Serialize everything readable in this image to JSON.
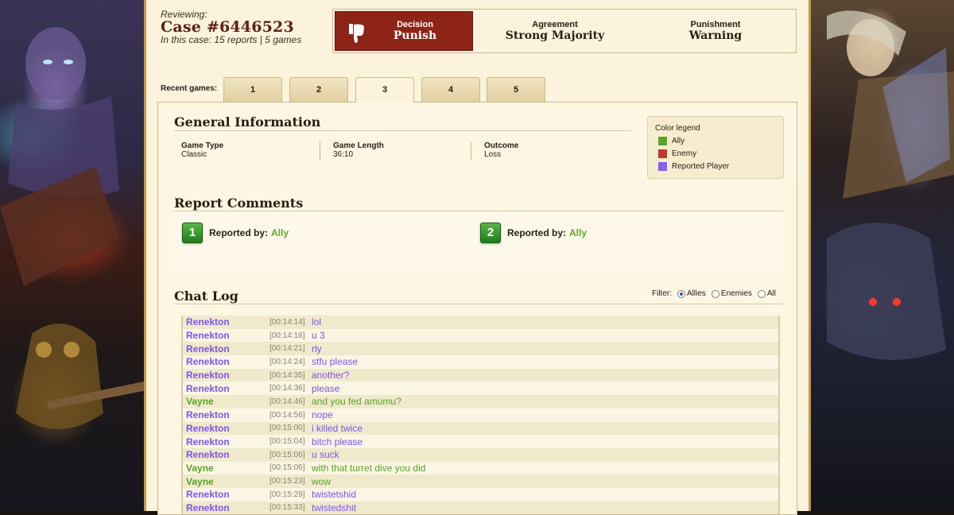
{
  "case": {
    "reviewing_label": "Reviewing:",
    "title": "Case #6446523",
    "subtitle": "In this case: 15 reports | 5 games"
  },
  "verdict": {
    "decision_label": "Decision",
    "decision_value": "Punish",
    "agreement_label": "Agreement",
    "agreement_value": "Strong Majority",
    "punishment_label": "Punishment",
    "punishment_value": "Warning",
    "decision_color": "#8e2418"
  },
  "games": {
    "label": "Recent games:",
    "tabs": [
      "1",
      "2",
      "3",
      "4",
      "5"
    ],
    "active_index": 2
  },
  "general_info": {
    "title": "General Information",
    "game_type_label": "Game Type",
    "game_type_value": "Classic",
    "game_length_label": "Game Length",
    "game_length_value": "36:10",
    "outcome_label": "Outcome",
    "outcome_value": "Loss"
  },
  "legend": {
    "title": "Color legend",
    "items": [
      {
        "label": "Ally",
        "color": "#5aa52b"
      },
      {
        "label": "Enemy",
        "color": "#c0392b"
      },
      {
        "label": "Reported Player",
        "color": "#8a5cf0"
      }
    ]
  },
  "report_comments": {
    "title": "Report Comments",
    "reports": [
      {
        "number": "1",
        "label": "Reported by:",
        "by": "Ally"
      },
      {
        "number": "2",
        "label": "Reported by:",
        "by": "Ally"
      }
    ]
  },
  "chat_log": {
    "title": "Chat Log",
    "filter_label": "Filter:",
    "filters": [
      "Allies",
      "Enemies",
      "All"
    ],
    "selected_filter": "Allies",
    "messages": [
      {
        "name": "Renekton",
        "time": "[00:14:14]",
        "text": "lol",
        "team": "reported"
      },
      {
        "name": "Renekton",
        "time": "[00:14:18]",
        "text": "u 3",
        "team": "reported"
      },
      {
        "name": "Renekton",
        "time": "[00:14:21]",
        "text": "rly",
        "team": "reported"
      },
      {
        "name": "Renekton",
        "time": "[00:14:24]",
        "text": "stfu please",
        "team": "reported"
      },
      {
        "name": "Renekton",
        "time": "[00:14:35]",
        "text": "another?",
        "team": "reported"
      },
      {
        "name": "Renekton",
        "time": "[00:14:36]",
        "text": "please",
        "team": "reported"
      },
      {
        "name": "Vayne",
        "time": "[00:14:46]",
        "text": "and you fed amumu?",
        "team": "ally"
      },
      {
        "name": "Renekton",
        "time": "[00:14:56]",
        "text": "nope",
        "team": "reported"
      },
      {
        "name": "Renekton",
        "time": "[00:15:00]",
        "text": "i killed twice",
        "team": "reported"
      },
      {
        "name": "Renekton",
        "time": "[00:15:04]",
        "text": "bitch please",
        "team": "reported"
      },
      {
        "name": "Renekton",
        "time": "[00:15:06]",
        "text": "u suck",
        "team": "reported"
      },
      {
        "name": "Vayne",
        "time": "[00:15:06]",
        "text": "with that turret dive you did",
        "team": "ally"
      },
      {
        "name": "Vayne",
        "time": "[00:15:23]",
        "text": "wow",
        "team": "ally"
      },
      {
        "name": "Renekton",
        "time": "[00:15:29]",
        "text": "twistetshid",
        "team": "reported"
      },
      {
        "name": "Renekton",
        "time": "[00:15:33]",
        "text": "twistedshit",
        "team": "reported"
      }
    ]
  }
}
